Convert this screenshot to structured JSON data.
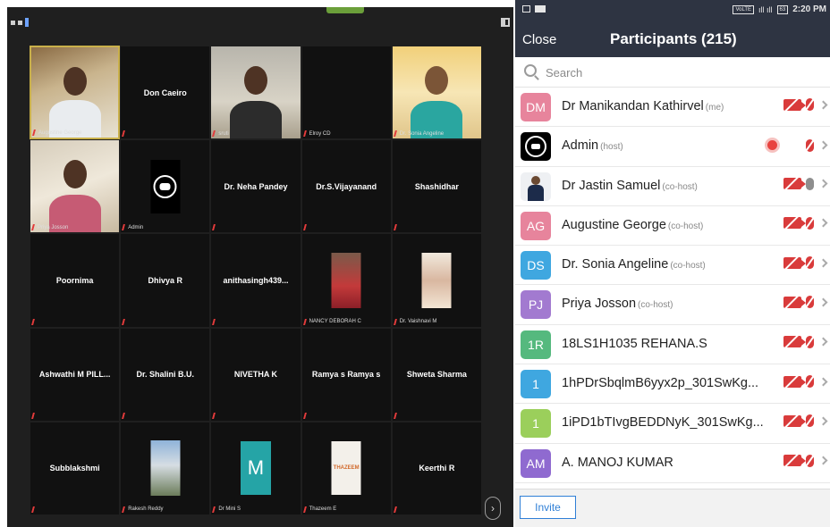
{
  "gallery": {
    "tiles": [
      {
        "name": "",
        "label": "Augustine George",
        "video": "room",
        "active": true
      },
      {
        "name": "Don Caeiro",
        "label": ""
      },
      {
        "name": "",
        "label": "sruti",
        "video": "room2"
      },
      {
        "name": "",
        "label": "Elroy CD"
      },
      {
        "name": "",
        "label": "Dr. Sonia Angeline",
        "video": "yellow"
      },
      {
        "name": "",
        "label": "Priya Josson",
        "video": "home"
      },
      {
        "name": "",
        "label": "Admin",
        "video": "logo"
      },
      {
        "name": "Dr. Neha Pandey",
        "label": ""
      },
      {
        "name": "Dr.S.Vijayanand",
        "label": ""
      },
      {
        "name": "Shashidhar",
        "label": ""
      },
      {
        "name": "Poornima",
        "label": ""
      },
      {
        "name": "Dhivya R",
        "label": ""
      },
      {
        "name": "anithasingh439...",
        "label": ""
      },
      {
        "name": "",
        "label": "NANCY DEBORAH C",
        "video": "photo-red"
      },
      {
        "name": "",
        "label": "Dr. Vaishnavi M",
        "video": "photo-light"
      },
      {
        "name": "Ashwathi M PILL...",
        "label": ""
      },
      {
        "name": "Dr. Shalini B.U.",
        "label": ""
      },
      {
        "name": "NIVETHA K",
        "label": ""
      },
      {
        "name": "Ramya s Ramya s",
        "label": ""
      },
      {
        "name": "Shweta Sharma",
        "label": ""
      },
      {
        "name": "Subblakshmi",
        "label": ""
      },
      {
        "name": "",
        "label": "Rakesh Reddy",
        "video": "photo-outdoor"
      },
      {
        "name": "",
        "label": "Dr Mini S",
        "video": "m"
      },
      {
        "name": "",
        "label": "Thazeem E",
        "video": "thazeem"
      },
      {
        "name": "Keerthi R",
        "label": ""
      }
    ],
    "m_letter": "M",
    "thazeem_text": "THAZEEM",
    "next_icon": "chevron-right-icon",
    "next_glyph": "›"
  },
  "status_bar": {
    "volte": "VoLTE",
    "battery": "63",
    "time": "2:20 PM"
  },
  "header": {
    "close_label": "Close",
    "title": "Participants (215)"
  },
  "search": {
    "placeholder": "Search"
  },
  "participants": [
    {
      "initials": "DM",
      "color": "#e7849c",
      "name": "Dr Manikandan Kathirvel",
      "role": "(me)",
      "cam": "off",
      "mic": "muted"
    },
    {
      "initials": "",
      "avatar": "admin-logo",
      "name": "Admin",
      "role": "(host)",
      "cam": "recording",
      "mic": "muted"
    },
    {
      "initials": "",
      "avatar": "person-photo",
      "name": "Dr Jastin Samuel",
      "role": "(co-host)",
      "cam": "off",
      "mic": "unmuted"
    },
    {
      "initials": "AG",
      "color": "#e7849c",
      "name": "Augustine George",
      "role": "(co-host)",
      "cam": "off",
      "mic": "muted"
    },
    {
      "initials": "DS",
      "color": "#3fa7e0",
      "name": "Dr. Sonia Angeline",
      "role": "(co-host)",
      "cam": "off",
      "mic": "muted"
    },
    {
      "initials": "PJ",
      "color": "#a27ad0",
      "name": "Priya Josson",
      "role": "(co-host)",
      "cam": "off",
      "mic": "muted"
    },
    {
      "initials": "1R",
      "color": "#55b97e",
      "name": "18LS1H1035 REHANA.S",
      "role": "",
      "cam": "off",
      "mic": "muted"
    },
    {
      "initials": "1",
      "color": "#3fa7e0",
      "name": "1hPDrSbqlmB6yyx2p_301SwKg...",
      "role": "",
      "cam": "off",
      "mic": "muted"
    },
    {
      "initials": "1",
      "color": "#9bcf5b",
      "name": "1iPD1bTIvgBEDDNyK_301SwKg...",
      "role": "",
      "cam": "off",
      "mic": "muted"
    },
    {
      "initials": "AM",
      "color": "#8f6ad0",
      "name": "A. MANOJ KUMAR",
      "role": "",
      "cam": "off",
      "mic": "muted"
    }
  ],
  "footer": {
    "invite_label": "Invite"
  }
}
